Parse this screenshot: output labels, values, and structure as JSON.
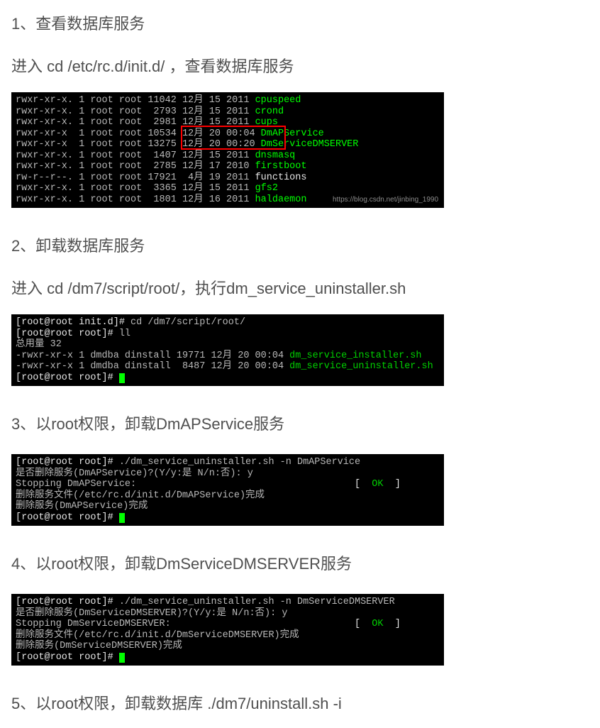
{
  "section1": {
    "heading": "1、查看数据库服务",
    "sub": "进入   cd /etc/rc.d/init.d/ ，查看数据库服务",
    "watermark": "https://blog.csdn.net/jinbing_1990",
    "lines": [
      {
        "perm": "rwxr-xr-x. 1 root root 11042 12月 15 2011 ",
        "name": "cpuspeed",
        "cls": "grn"
      },
      {
        "perm": "rwxr-xr-x. 1 root root  2793 12月 15 2011 ",
        "name": "crond",
        "cls": "grn"
      },
      {
        "perm": "rwxr-xr-x. 1 root root  2981 12月 15 2011 ",
        "name": "cups",
        "cls": "grn"
      },
      {
        "perm": "rwxr-xr-x  1 root root 10534 12月 20 00:04 ",
        "name": "DmAPService",
        "cls": "grn"
      },
      {
        "perm": "rwxr-xr-x  1 root root 13275 12月 20 00:20 ",
        "name": "DmServiceDMSERVER",
        "cls": "grn"
      },
      {
        "perm": "rwxr-xr-x. 1 root root  1407 12月 15 2011 ",
        "name": "dnsmasq",
        "cls": "grn"
      },
      {
        "perm": "rwxr-xr-x. 1 root root  2785 12月 17 2010 ",
        "name": "firstboot",
        "cls": "grn"
      },
      {
        "perm": "rw-r--r--. 1 root root 17921  4月 19 2011 ",
        "name": "functions",
        "cls": "wht"
      },
      {
        "perm": "rwxr-xr-x. 1 root root  3365 12月 15 2011 ",
        "name": "gfs2",
        "cls": "grn"
      },
      {
        "perm": "rwxr-xr-x. 1 root root  1801 12月 16 2011 ",
        "name": "haldaemon",
        "cls": "grn"
      }
    ]
  },
  "section2": {
    "heading": "2、卸载数据库服务",
    "sub": "进入  cd /dm7/script/root/，执行dm_service_uninstaller.sh",
    "l1_pre": "[root@root init.d]# ",
    "l1_cmd": "cd /dm7/script/root/",
    "l2_pre": "[root@root root]# ",
    "l2_cmd": "ll",
    "l3": "总用量 32",
    "l4p": "-rwxr-xr-x 1 dmdba dinstall 19771 12月 20 00:04 ",
    "l4n": "dm_service_installer.sh",
    "l5p": "-rwxr-xr-x 1 dmdba dinstall  8487 12月 20 00:04 ",
    "l5n": "dm_service_uninstaller.sh",
    "l6": "[root@root root]# "
  },
  "section3": {
    "heading": "3、以root权限，卸载DmAPService服务",
    "l1p": "[root@root root]# ",
    "l1c": "./dm_service_uninstaller.sh -n DmAPService",
    "l2": "是否删除服务(DmAPService)?(Y/y:是 N/n:否): y",
    "l3a": "Stopping DmAPService:                                      ",
    "l3b": "[ ",
    "l3c": " OK ",
    "l3d": " ]",
    "l4": "删除服务文件(/etc/rc.d/init.d/DmAPService)完成",
    "l5": "删除服务(DmAPService)完成",
    "l6": "[root@root root]# "
  },
  "section4": {
    "heading": "4、以root权限，卸载DmServiceDMSERVER服务",
    "l1p": "[root@root root]# ",
    "l1c": "./dm_service_uninstaller.sh -n DmServiceDMSERVER",
    "l2": "是否删除服务(DmServiceDMSERVER)?(Y/y:是 N/n:否): y",
    "l3a": "Stopping DmServiceDMSERVER:                                ",
    "l3b": "[ ",
    "l3c": " OK ",
    "l3d": " ]",
    "l4": "删除服务文件(/etc/rc.d/init.d/DmServiceDMSERVER)完成",
    "l5": "删除服务(DmServiceDMSERVER)完成",
    "l6": "[root@root root]# "
  },
  "section5": {
    "heading": "5、以root权限，卸载数据库    ./dm7/uninstall.sh -i"
  }
}
